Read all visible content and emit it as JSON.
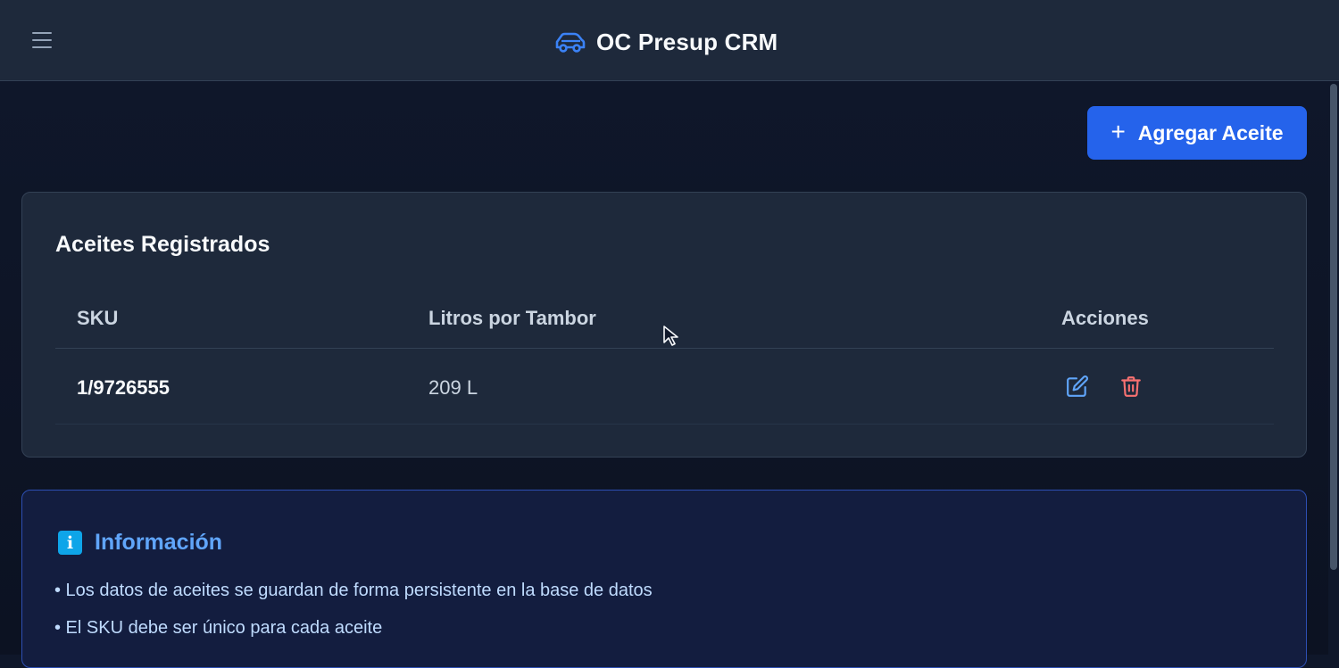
{
  "header": {
    "menu_icon": "hamburger-menu-icon",
    "brand_icon": "car-icon",
    "title": "OC Presup CRM"
  },
  "toolbar": {
    "add_label": "Agregar Aceite",
    "add_icon": "plus-icon"
  },
  "oils_card": {
    "title": "Aceites Registrados",
    "columns": [
      "SKU",
      "Litros por Tambor",
      "Acciones"
    ],
    "rows": [
      {
        "sku": "1/9726555",
        "litros": "209 L",
        "actions": [
          "edit-icon",
          "trash-icon"
        ]
      }
    ]
  },
  "info": {
    "icon": "info-icon",
    "icon_glyph": "i",
    "title": "Información",
    "items": [
      "• Los datos de aceites se guardan de forma persistente en la base de datos",
      "• El SKU debe ser único para cada aceite"
    ]
  },
  "colors": {
    "accent": "#2563eb",
    "surface": "#1e293b",
    "background": "#0f172a",
    "edit": "#60a5fa",
    "delete": "#f87171",
    "info_border": "#2d4fb3"
  }
}
